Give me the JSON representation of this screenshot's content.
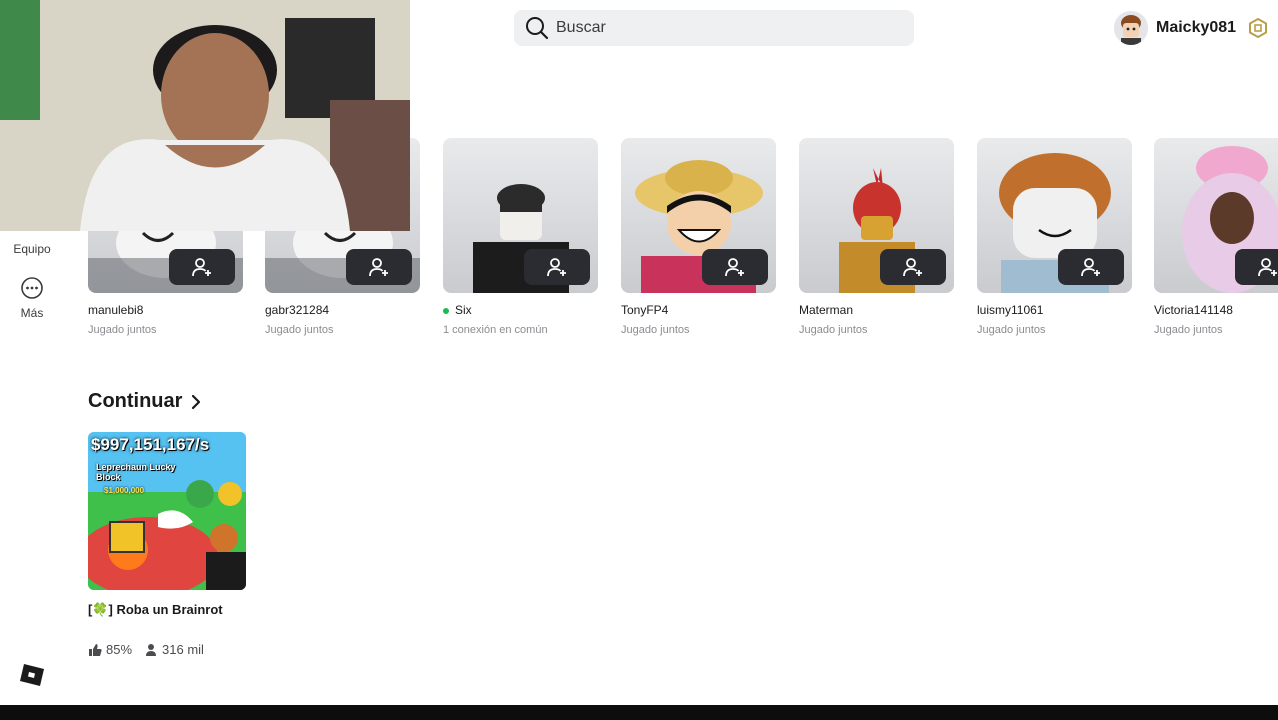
{
  "header": {
    "search_placeholder": "Buscar",
    "username": "Maicky081"
  },
  "sidebar": {
    "items": [
      {
        "label": "Equipo",
        "icon": "team-icon"
      },
      {
        "label": "Más",
        "icon": "more-icon"
      }
    ]
  },
  "friends": [
    {
      "name": "manulebi8",
      "status": "Jugado juntos",
      "online": false
    },
    {
      "name": "gabr321284",
      "status": "Jugado juntos",
      "online": false
    },
    {
      "name": "Six",
      "status": "1 conexión en común",
      "online": true
    },
    {
      "name": "TonyFP4",
      "status": "Jugado juntos",
      "online": false
    },
    {
      "name": "Materman",
      "status": "Jugado juntos",
      "online": false
    },
    {
      "name": "luismy11061",
      "status": "Jugado juntos",
      "online": false
    },
    {
      "name": "Victoria141148",
      "status": "Jugado juntos",
      "online": false
    }
  ],
  "continue_section": {
    "title": "Continuar",
    "games": [
      {
        "title": "[🍀] Roba un Brainrot",
        "thumb_text": "$997,151,167/s",
        "thumb_subtext": "Leprechaun Lucky Block",
        "thumb_badge": "$1,000,000",
        "rating": "85%",
        "players": "316 mil"
      }
    ]
  },
  "colors": {
    "online": "#1db954",
    "add_button": "#2a2c31",
    "search_bg": "#eef0f2"
  }
}
